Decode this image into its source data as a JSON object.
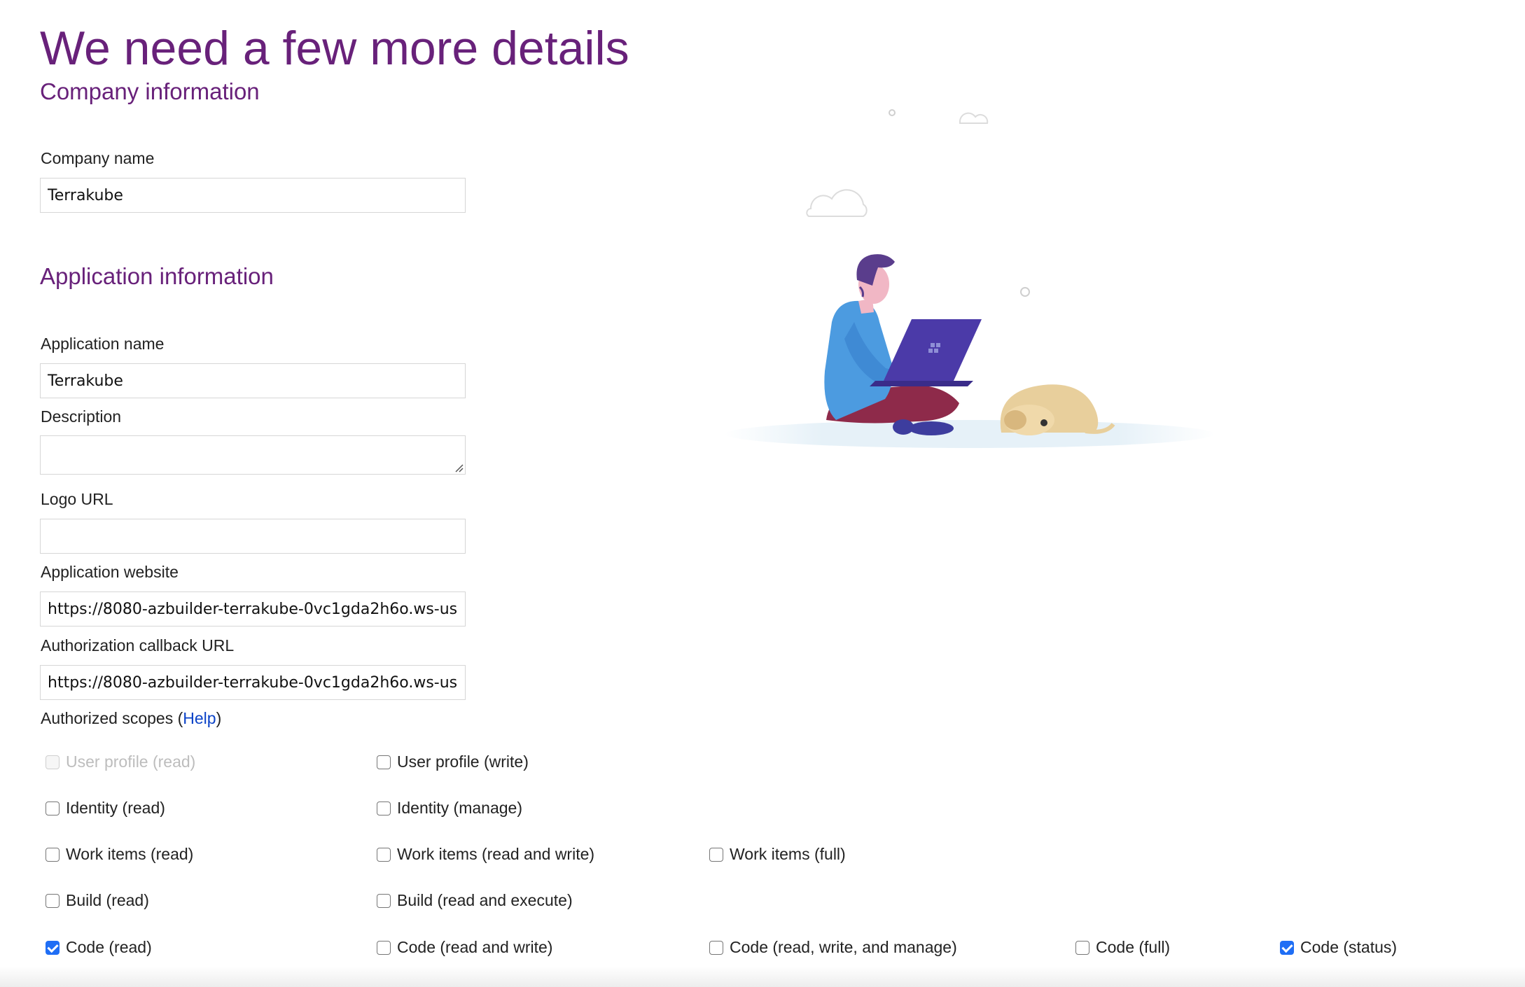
{
  "page": {
    "title": "We need a few more details"
  },
  "company_section": {
    "heading": "Company information",
    "company_name_label": "Company name",
    "company_name_value": "Terrakube"
  },
  "application_section": {
    "heading": "Application information",
    "app_name_label": "Application name",
    "app_name_value": "Terrakube",
    "description_label": "Description",
    "description_value": "",
    "logo_url_label": "Logo URL",
    "logo_url_value": "",
    "website_label": "Application website",
    "website_value": "https://8080-azbuilder-terrakube-0vc1gda2h6o.ws-us",
    "callback_label": "Authorization callback URL",
    "callback_value": "https://8080-azbuilder-terrakube-0vc1gda2h6o.ws-us"
  },
  "scopes": {
    "label_prefix": "Authorized scopes (",
    "help_link": "Help",
    "label_suffix": ")",
    "items": [
      {
        "label": "User profile (read)",
        "checked": false,
        "disabled": true
      },
      {
        "label": "User profile (write)",
        "checked": false,
        "disabled": false
      },
      {
        "label": "Identity (read)",
        "checked": false,
        "disabled": false
      },
      {
        "label": "Identity (manage)",
        "checked": false,
        "disabled": false
      },
      {
        "label": "Work items (read)",
        "checked": false,
        "disabled": false
      },
      {
        "label": "Work items (read and write)",
        "checked": false,
        "disabled": false
      },
      {
        "label": "Work items (full)",
        "checked": false,
        "disabled": false
      },
      {
        "label": "Build (read)",
        "checked": false,
        "disabled": false
      },
      {
        "label": "Build (read and execute)",
        "checked": false,
        "disabled": false
      },
      {
        "label": "Code (read)",
        "checked": true,
        "disabled": false
      },
      {
        "label": "Code (read and write)",
        "checked": false,
        "disabled": false
      },
      {
        "label": "Code (read, write, and manage)",
        "checked": false,
        "disabled": false
      },
      {
        "label": "Code (full)",
        "checked": false,
        "disabled": false
      },
      {
        "label": "Code (status)",
        "checked": true,
        "disabled": false
      }
    ]
  },
  "colors": {
    "heading_purple": "#68217a",
    "link_blue": "#0b43c8",
    "checkbox_blue": "#1f6ef5"
  },
  "illustration": {
    "icon": "person-with-laptop-and-dog-illustration"
  }
}
